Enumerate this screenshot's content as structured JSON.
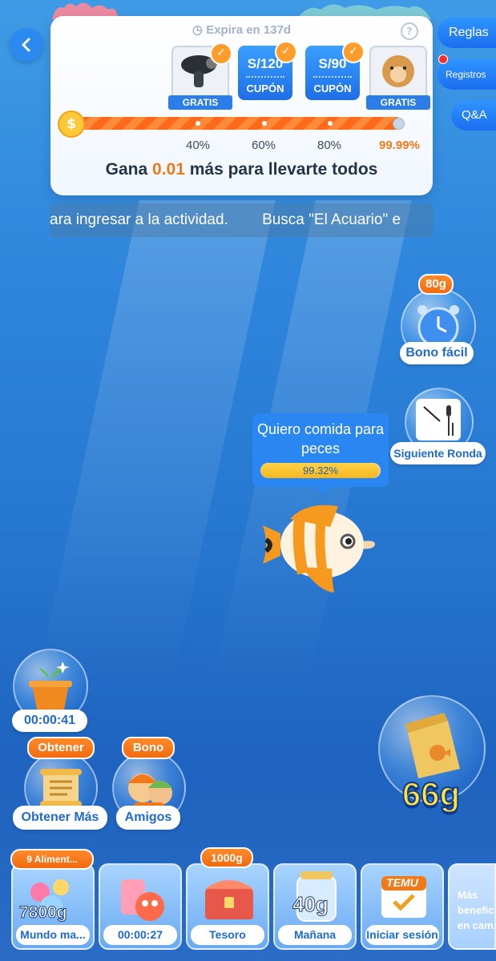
{
  "header": {
    "expire_text": "Expira en 137d",
    "help_icon": "?"
  },
  "rewards": [
    {
      "type": "gift",
      "tag": "GRATIS",
      "claimed": true,
      "icon": "hairdryer-icon"
    },
    {
      "type": "coupon",
      "amount": "S/120",
      "label": "CUPÓN",
      "claimed": true
    },
    {
      "type": "coupon",
      "amount": "S/90",
      "label": "CUPÓN",
      "claimed": true
    },
    {
      "type": "gift",
      "tag": "GRATIS",
      "claimed": false,
      "icon": "plush-toy-icon"
    }
  ],
  "progress": {
    "value": 99.99,
    "coin_symbol": "$",
    "milestones": [
      "40%",
      "60%",
      "80%",
      "99.99%"
    ]
  },
  "card_text": {
    "prefix": "Gana ",
    "amount": "0.01",
    "suffix": " más para llevarte todos"
  },
  "marquee": "ara ingresar a la actividad.        Busca \"El Acuario\" e",
  "side": {
    "reglas": "Reglas",
    "registros": "Registros",
    "qa": "Q&A"
  },
  "bono_facil": {
    "amount": "80g",
    "label": "Bono fácil"
  },
  "siguiente_ronda": {
    "label": "Siguiente Ronda"
  },
  "fish": {
    "message": "Quiero comida para peces",
    "progress_text": "99.32%",
    "progress_value": 99.32
  },
  "plant": {
    "timer": "00:00:41"
  },
  "obtener": {
    "tag": "Obtener",
    "label": "Obtener Más"
  },
  "amigos": {
    "tag": "Bono",
    "label": "Amigos"
  },
  "food": {
    "amount": "66g"
  },
  "bottom_items": [
    {
      "tag": "9 Aliment...",
      "badge": "7800g",
      "label": "Mundo ma..."
    },
    {
      "tag": "",
      "badge": "",
      "label": "00:00:27"
    },
    {
      "tag": "1000g",
      "badge": "",
      "label": "Tesoro"
    },
    {
      "tag": "",
      "badge": "40g",
      "label": "Mañana"
    },
    {
      "tag": "",
      "badge": "TEMU",
      "label": "Iniciar sesión"
    },
    {
      "tag": "",
      "badge": "",
      "label": "Más beneficios en cam..."
    }
  ],
  "colors": {
    "accent_orange": "#f07a1a",
    "accent_blue": "#1c6ad2",
    "ocean": "#2677d0"
  }
}
